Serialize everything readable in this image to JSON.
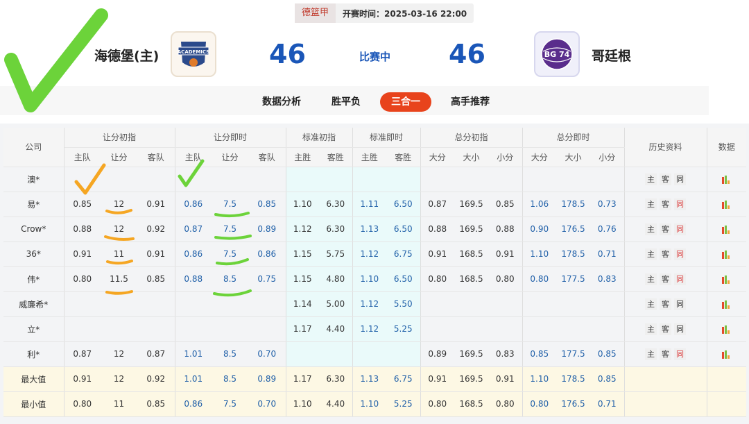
{
  "league": "德篮甲",
  "match_time": "开赛时间：2025-03-16 22:00",
  "home": {
    "name": "海德堡(主)",
    "score": "46",
    "logo_text": "ACADEMICS"
  },
  "away": {
    "name": "哥廷根",
    "score": "46",
    "logo_text": "BG 74"
  },
  "status": "比赛中",
  "tabs": [
    "数据分析",
    "胜平负",
    "三合一",
    "高手推荐"
  ],
  "active_tab": "三合一",
  "headers": {
    "company": "公司",
    "groups": [
      "让分初指",
      "让分即时",
      "标准初指",
      "标准即时",
      "总分初指",
      "总分即时",
      "历史资料",
      "数据"
    ],
    "sub": [
      "主队",
      "让分",
      "客队",
      "主队",
      "让分",
      "客队",
      "主胜",
      "客胜",
      "主胜",
      "客胜",
      "大分",
      "大小",
      "小分",
      "大分",
      "大小",
      "小分"
    ]
  },
  "history_labels": [
    "主",
    "客",
    "同"
  ],
  "rows": [
    {
      "company": "澳*",
      "hc": [
        "",
        "",
        ""
      ],
      "hl": [
        "",
        "",
        ""
      ],
      "sc": [
        "",
        ""
      ],
      "sl": [
        "",
        ""
      ],
      "tc": [
        "",
        "",
        ""
      ],
      "tl": [
        "",
        "",
        ""
      ],
      "red": false
    },
    {
      "company": "易*",
      "hc": [
        "0.85",
        "12",
        "0.91"
      ],
      "hl": [
        "0.86",
        "7.5",
        "0.85"
      ],
      "sc": [
        "1.10",
        "6.30"
      ],
      "sl": [
        "1.11",
        "6.50"
      ],
      "tc": [
        "0.87",
        "169.5",
        "0.85"
      ],
      "tl": [
        "1.06",
        "178.5",
        "0.73"
      ],
      "red": true
    },
    {
      "company": "Crow*",
      "hc": [
        "0.88",
        "12",
        "0.92"
      ],
      "hl": [
        "0.87",
        "7.5",
        "0.89"
      ],
      "sc": [
        "1.12",
        "6.30"
      ],
      "sl": [
        "1.13",
        "6.50"
      ],
      "tc": [
        "0.88",
        "169.5",
        "0.88"
      ],
      "tl": [
        "0.90",
        "176.5",
        "0.76"
      ],
      "red": true
    },
    {
      "company": "36*",
      "hc": [
        "0.91",
        "11",
        "0.91"
      ],
      "hl": [
        "0.86",
        "7.5",
        "0.86"
      ],
      "sc": [
        "1.15",
        "5.75"
      ],
      "sl": [
        "1.12",
        "6.75"
      ],
      "tc": [
        "0.91",
        "168.5",
        "0.91"
      ],
      "tl": [
        "1.10",
        "178.5",
        "0.71"
      ],
      "red": true
    },
    {
      "company": "伟*",
      "hc": [
        "0.80",
        "11.5",
        "0.85"
      ],
      "hl": [
        "0.88",
        "8.5",
        "0.75"
      ],
      "sc": [
        "1.15",
        "4.80"
      ],
      "sl": [
        "1.10",
        "6.50"
      ],
      "tc": [
        "0.80",
        "168.5",
        "0.80"
      ],
      "tl": [
        "0.80",
        "177.5",
        "0.83"
      ],
      "red": true
    },
    {
      "company": "威廉希*",
      "hc": [
        "",
        "",
        ""
      ],
      "hl": [
        "",
        "",
        ""
      ],
      "sc": [
        "1.14",
        "5.00"
      ],
      "sl": [
        "1.12",
        "5.50"
      ],
      "tc": [
        "",
        "",
        ""
      ],
      "tl": [
        "",
        "",
        ""
      ],
      "red": false
    },
    {
      "company": "立*",
      "hc": [
        "",
        "",
        ""
      ],
      "hl": [
        "",
        "",
        ""
      ],
      "sc": [
        "1.17",
        "4.40"
      ],
      "sl": [
        "1.12",
        "5.25"
      ],
      "tc": [
        "",
        "",
        ""
      ],
      "tl": [
        "",
        "",
        ""
      ],
      "red": false
    },
    {
      "company": "利*",
      "hc": [
        "0.87",
        "12",
        "0.87"
      ],
      "hl": [
        "1.01",
        "8.5",
        "0.70"
      ],
      "sc": [
        "",
        ""
      ],
      "sl": [
        "",
        ""
      ],
      "tc": [
        "0.89",
        "169.5",
        "0.83"
      ],
      "tl": [
        "0.85",
        "177.5",
        "0.85"
      ],
      "red": true
    }
  ],
  "summary": [
    {
      "label": "最大值",
      "hc": [
        "0.91",
        "12",
        "0.92"
      ],
      "hl": [
        "1.01",
        "8.5",
        "0.89"
      ],
      "sc": [
        "1.17",
        "6.30"
      ],
      "sl": [
        "1.13",
        "6.75"
      ],
      "tc": [
        "0.91",
        "169.5",
        "0.91"
      ],
      "tl": [
        "1.10",
        "178.5",
        "0.85"
      ]
    },
    {
      "label": "最小值",
      "hc": [
        "0.80",
        "11",
        "0.85"
      ],
      "hl": [
        "0.86",
        "7.5",
        "0.70"
      ],
      "sc": [
        "1.10",
        "4.40"
      ],
      "sl": [
        "1.10",
        "5.25"
      ],
      "tc": [
        "0.80",
        "168.5",
        "0.80"
      ],
      "tl": [
        "0.80",
        "176.5",
        "0.71"
      ]
    }
  ],
  "colors": {
    "accent": "#e8431c",
    "score": "#1a56b8",
    "odds_blue": "#1f5fa8",
    "check_green": "#6cd33a",
    "mark_orange": "#f5a623"
  }
}
